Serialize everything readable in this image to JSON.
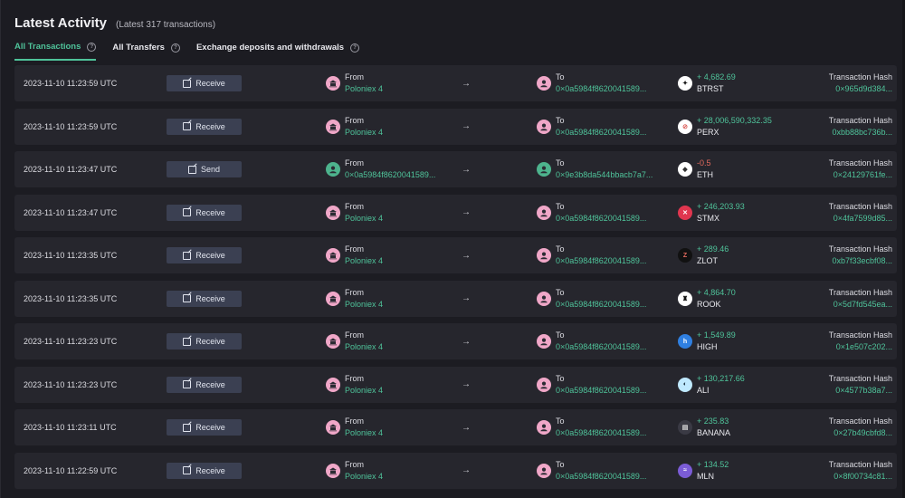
{
  "header": {
    "title": "Latest Activity",
    "subtitle": "(Latest 317 transactions)"
  },
  "tabs": [
    {
      "label": "All Transactions",
      "active": true,
      "help": "?"
    },
    {
      "label": "All Transfers",
      "active": false,
      "help": "?"
    },
    {
      "label": "Exchange deposits and withdrawals",
      "active": false,
      "help": "?"
    }
  ],
  "arrow_glyph": "→",
  "rows": [
    {
      "time": "2023-11-10 11:23:59 UTC",
      "action": "Receive",
      "from_label": "From",
      "from_value": "Poloniex 4",
      "from_icon": "bank-icon",
      "to_label": "To",
      "to_value": "0×0a5984f862004158​9...",
      "to_icon": "user-icon",
      "amount": "+ 4,682.69",
      "symbol": "BTRST",
      "token_icon": "btrst-token-icon",
      "hash_label": "Transaction Hash",
      "hash": "0×965d9d384..."
    },
    {
      "time": "2023-11-10 11:23:59 UTC",
      "action": "Receive",
      "from_label": "From",
      "from_value": "Poloniex 4",
      "from_icon": "bank-icon",
      "to_label": "To",
      "to_value": "0×0a5984f8620041589...",
      "to_icon": "user-icon",
      "amount": "+ 28,006,590,332.35",
      "symbol": "PERX",
      "token_icon": "perx-token-icon",
      "hash_label": "Transaction Hash",
      "hash": "0xbb88bc736b..."
    },
    {
      "time": "2023-11-10 11:23:47 UTC",
      "action": "Send",
      "from_label": "From",
      "from_value": "0×0a5984f8620041589...",
      "from_icon": "user-icon",
      "to_label": "To",
      "to_value": "0×9e3b8da544bbacb7a7...",
      "to_icon": "user-icon",
      "amount": "-0.5",
      "negative": true,
      "symbol": "ETH",
      "token_icon": "eth-token-icon",
      "hash_label": "Transaction Hash",
      "hash": "0×24129761fe..."
    },
    {
      "time": "2023-11-10 11:23:47 UTC",
      "action": "Receive",
      "from_label": "From",
      "from_value": "Poloniex 4",
      "from_icon": "bank-icon",
      "to_label": "To",
      "to_value": "0×0a5984f8620041589...",
      "to_icon": "user-icon",
      "amount": "+ 246,203.93",
      "symbol": "STMX",
      "token_icon": "stmx-token-icon",
      "hash_label": "Transaction Hash",
      "hash": "0×4fa7599d85..."
    },
    {
      "time": "2023-11-10 11:23:35 UTC",
      "action": "Receive",
      "from_label": "From",
      "from_value": "Poloniex 4",
      "from_icon": "bank-icon",
      "to_label": "To",
      "to_value": "0×0a5984f8620041589...",
      "to_icon": "user-icon",
      "amount": "+ 289.46",
      "symbol": "ZLOT",
      "token_icon": "zlot-token-icon",
      "hash_label": "Transaction Hash",
      "hash": "0xb7f33ecbf08..."
    },
    {
      "time": "2023-11-10 11:23:35 UTC",
      "action": "Receive",
      "from_label": "From",
      "from_value": "Poloniex 4",
      "from_icon": "bank-icon",
      "to_label": "To",
      "to_value": "0×0a5984f8620041589...",
      "to_icon": "user-icon",
      "amount": "+ 4,864.70",
      "symbol": "ROOK",
      "token_icon": "rook-token-icon",
      "hash_label": "Transaction Hash",
      "hash": "0×5d7fd545ea..."
    },
    {
      "time": "2023-11-10 11:23:23 UTC",
      "action": "Receive",
      "from_label": "From",
      "from_value": "Poloniex 4",
      "from_icon": "bank-icon",
      "to_label": "To",
      "to_value": "0×0a5984f8620041589...",
      "to_icon": "user-icon",
      "amount": "+ 1,549.89",
      "symbol": "HIGH",
      "token_icon": "high-token-icon",
      "hash_label": "Transaction Hash",
      "hash": "0×1e507c202..."
    },
    {
      "time": "2023-11-10 11:23:23 UTC",
      "action": "Receive",
      "from_label": "From",
      "from_value": "Poloniex 4",
      "from_icon": "bank-icon",
      "to_label": "To",
      "to_value": "0×0a5984f8620041589...",
      "to_icon": "user-icon",
      "amount": "+ 130,217.66",
      "symbol": "ALI",
      "token_icon": "ali-token-icon",
      "hash_label": "Transaction Hash",
      "hash": "0×4577b38a7..."
    },
    {
      "time": "2023-11-10 11:23:11 UTC",
      "action": "Receive",
      "from_label": "From",
      "from_value": "Poloniex 4",
      "from_icon": "bank-icon",
      "to_label": "To",
      "to_value": "0×0a5984f8620041589...",
      "to_icon": "user-icon",
      "amount": "+ 235.83",
      "symbol": "BANANA",
      "token_icon": "banana-token-icon",
      "hash_label": "Transaction Hash",
      "hash": "0×27b49cbfd8..."
    },
    {
      "time": "2023-11-10 11:22:59 UTC",
      "action": "Receive",
      "from_label": "From",
      "from_value": "Poloniex 4",
      "from_icon": "bank-icon",
      "to_label": "To",
      "to_value": "0×0a5984f8620041589...",
      "to_icon": "user-icon",
      "amount": "+ 134.52",
      "symbol": "MLN",
      "token_icon": "mln-token-icon",
      "hash_label": "Transaction Hash",
      "hash": "0×8f00734c81..."
    }
  ],
  "colors": {
    "accent": "#4fc39a",
    "negative": "#e36a5e",
    "button": "#3b4052",
    "row": "#26262d"
  }
}
